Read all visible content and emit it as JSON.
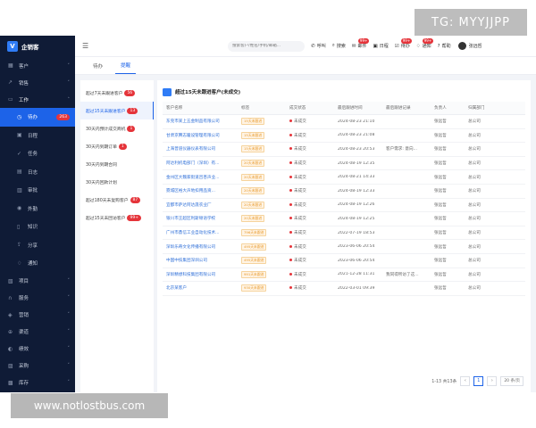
{
  "watermark": {
    "top": "TG: MYYJJPP",
    "bottom": "www.notlostbus.com"
  },
  "brand": {
    "name": "企销客"
  },
  "sidebar": {
    "items": [
      {
        "label": "客户",
        "icon": "grid-icon"
      },
      {
        "label": "销售",
        "icon": "chart-icon"
      },
      {
        "label": "工作",
        "icon": "briefcase-icon",
        "open": true
      }
    ],
    "sub_items": [
      {
        "label": "待办",
        "icon": "clock-icon",
        "badge": "263",
        "active": true
      },
      {
        "label": "日程",
        "icon": "calendar-icon"
      },
      {
        "label": "任务",
        "icon": "task-icon"
      },
      {
        "label": "日志",
        "icon": "log-icon"
      },
      {
        "label": "审批",
        "icon": "approve-icon"
      },
      {
        "label": "外勤",
        "icon": "location-icon"
      },
      {
        "label": "知识",
        "icon": "book-icon"
      },
      {
        "label": "分享",
        "icon": "share-icon"
      },
      {
        "label": "通知",
        "icon": "bell-icon"
      }
    ],
    "bottom_items": [
      {
        "label": "项目",
        "icon": "project-icon"
      },
      {
        "label": "服务",
        "icon": "headset-icon"
      },
      {
        "label": "营销",
        "icon": "marketing-icon"
      },
      {
        "label": "渠道",
        "icon": "channel-icon"
      },
      {
        "label": "绩效",
        "icon": "performance-icon"
      },
      {
        "label": "采购",
        "icon": "purchase-icon"
      },
      {
        "label": "库存",
        "icon": "inventory-icon"
      }
    ]
  },
  "topbar": {
    "search_placeholder": "搜索客户/姓名/手机/邮箱...",
    "actions": [
      {
        "label": "呼叫",
        "icon": "phone-icon"
      },
      {
        "label": "搜索",
        "icon": "search-icon"
      },
      {
        "label": "邮件",
        "icon": "mail-icon",
        "badge": "99+"
      },
      {
        "label": "日程",
        "icon": "calendar-icon"
      },
      {
        "label": "待办",
        "icon": "todo-icon",
        "badge": "99+"
      },
      {
        "label": "通知",
        "icon": "bell-icon",
        "badge": "99+"
      },
      {
        "label": "帮助",
        "icon": "help-icon"
      }
    ],
    "user_name": "张远哲"
  },
  "tabs": [
    {
      "label": "待办"
    },
    {
      "label": "提醒",
      "active": true
    }
  ],
  "filters": [
    {
      "label": "超过7天未跟进客户",
      "badge": "56"
    },
    {
      "label": "超过15天未跟进客户",
      "badge": "13",
      "active": true
    },
    {
      "label": "30天内预计成交商机",
      "badge": "1"
    },
    {
      "label": "30天内到期订单",
      "badge": "1"
    },
    {
      "label": "30天内到期合同",
      "badge": ""
    },
    {
      "label": "30天内回款计划",
      "badge": ""
    },
    {
      "label": "超过180天未复购客户",
      "badge": "87"
    },
    {
      "label": "超过15天未回访客户",
      "badge": "99+"
    }
  ],
  "panel": {
    "title": "超过15天未跟进客户(未成交)",
    "columns": [
      "客户名称",
      "标签",
      "成交状态",
      "最后跟进时间",
      "最后跟进记录",
      "负责人",
      "归属部门"
    ],
    "rows": [
      {
        "name": "东莞市某上五金制品有限公司",
        "tag": "15天未跟进",
        "status": "未成交",
        "time": "2024-08-23 21:10",
        "record": "",
        "owner": "张远哲",
        "dept": "总公司"
      },
      {
        "name": "甘肃京腾志暖设管理有限公司",
        "tag": "15天未跟进",
        "status": "未成交",
        "time": "2024-08-23 21:08",
        "record": "",
        "owner": "张远哲",
        "dept": "总公司"
      },
      {
        "name": "上海普道仪器仪表有限公司",
        "tag": "15天未跟进",
        "status": "未成交",
        "time": "2024-08-23 20:53",
        "record": "客户需求: 意向...",
        "owner": "张远哲",
        "dept": "总公司"
      },
      {
        "name": "阿达利机电部门（深圳）有...",
        "tag": "20天未跟进",
        "status": "未成交",
        "time": "2024-08-19 12:35",
        "record": "",
        "owner": "张远哲",
        "dept": "总公司"
      },
      {
        "name": "金州区大魏家街道吕杏声业...",
        "tag": "20天未跟进",
        "status": "未成交",
        "time": "2024-08-21 14:33",
        "record": "",
        "owner": "张远哲",
        "dept": "总公司"
      },
      {
        "name": "霓城区裕大声地扣用品资...",
        "tag": "20天未跟进",
        "status": "未成交",
        "time": "2024-08-19 12:33",
        "record": "",
        "owner": "张远哲",
        "dept": "总公司"
      },
      {
        "name": "宜都市萨达阿达晟农业厂",
        "tag": "20天未跟进",
        "status": "未成交",
        "time": "2024-08-19 12:26",
        "record": "",
        "owner": "张远哲",
        "dept": "总公司"
      },
      {
        "name": "银川市王超区利斯顿语学校",
        "tag": "20天未跟进",
        "status": "未成交",
        "time": "2024-08-19 12:25",
        "record": "",
        "owner": "张远哲",
        "dept": "总公司"
      },
      {
        "name": "广州市鼎信工业自动化技术...",
        "tag": "796天未跟进",
        "status": "未成交",
        "time": "2022-07-19 18:53",
        "record": "",
        "owner": "张远哲",
        "dept": "总公司"
      },
      {
        "name": "深圳乐奇文化传播有限公司",
        "tag": "495天未跟进",
        "status": "未成交",
        "time": "2023-06-06 20:54",
        "record": "",
        "owner": "张远哲",
        "dept": "总公司"
      },
      {
        "name": "中国中技集团深圳公司",
        "tag": "495天未跟进",
        "status": "未成交",
        "time": "2023-06-06 20:54",
        "record": "",
        "owner": "张远哲",
        "dept": "总公司"
      },
      {
        "name": "深圳精想科技集团有限公司",
        "tag": "991天未跟进",
        "status": "未成交",
        "time": "2021-12-28 11:31",
        "record": "我同得所访了这...",
        "owner": "张远哲",
        "dept": "总公司"
      },
      {
        "name": "北京某客户",
        "tag": "930天未跟进",
        "status": "未成交",
        "time": "2022-03-01 09:39",
        "record": "",
        "owner": "张远哲",
        "dept": "总公司"
      }
    ],
    "pager": {
      "summary": "1-13 共13条",
      "prev": "‹",
      "page": "1",
      "next": "›",
      "size": "20 条/页"
    }
  }
}
